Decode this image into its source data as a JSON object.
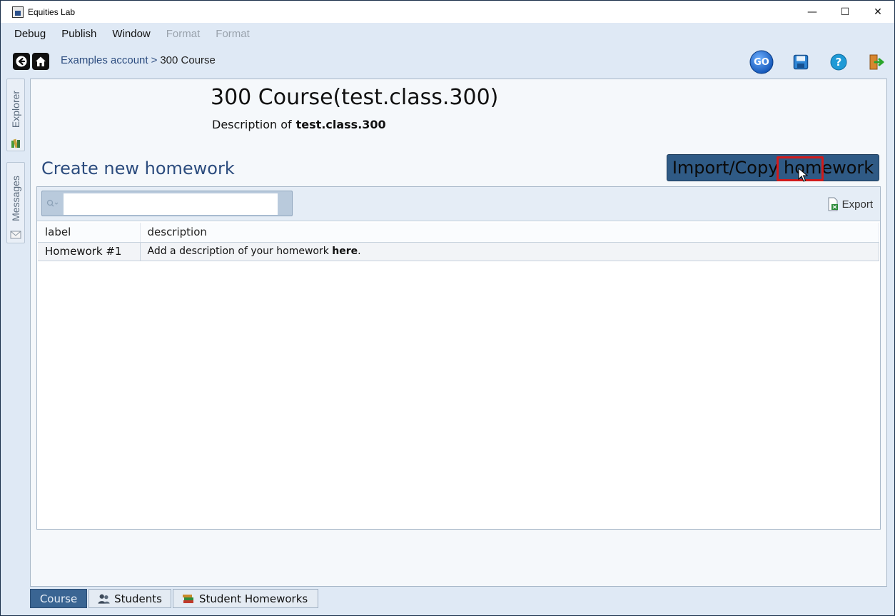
{
  "window": {
    "title": "Equities Lab",
    "minimize_glyph": "—",
    "maximize_glyph": "☐",
    "close_glyph": "✕"
  },
  "menu": {
    "items": [
      "Debug",
      "Publish",
      "Window",
      "Format",
      "Format"
    ]
  },
  "toolbar": {
    "breadcrumb_link": "Examples account",
    "breadcrumb_sep": ">",
    "breadcrumb_current": "300 Course",
    "go_label": "GO",
    "help_label": "?"
  },
  "sidebar": {
    "explorer_label": "Explorer",
    "messages_label": "Messages"
  },
  "course": {
    "title": "300 Course(test.class.300)",
    "description_prefix": "Description of",
    "description_id": "test.class.300"
  },
  "homework": {
    "create_label": "Create new homework",
    "import_label": "Import/Copy homework",
    "search_value": "",
    "export_label": "Export",
    "columns": [
      "label",
      "description"
    ],
    "rows": [
      {
        "label": "Homework #1",
        "description_text": "Add a description of your homework",
        "description_link": "here",
        "description_end": "."
      }
    ]
  },
  "bottom_tabs": [
    {
      "label": "Course",
      "active": true
    },
    {
      "label": "Students",
      "active": false
    },
    {
      "label": "Student Homeworks",
      "active": false
    }
  ],
  "colors": {
    "accent": "#2f5a85",
    "title_blue": "#2c4c7e",
    "highlight": "#d21a1a"
  }
}
